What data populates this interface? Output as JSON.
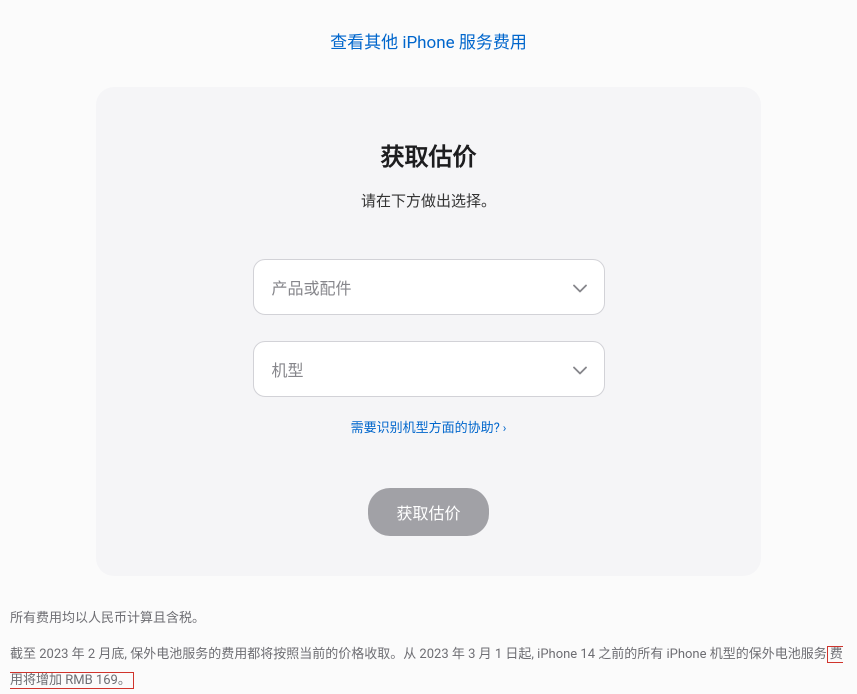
{
  "topLink": {
    "label": "查看其他 iPhone 服务费用"
  },
  "card": {
    "title": "获取估价",
    "subtitle": "请在下方做出选择。",
    "select1": {
      "placeholder": "产品或配件"
    },
    "select2": {
      "placeholder": "机型"
    },
    "helpLink": {
      "label": "需要识别机型方面的协助?"
    },
    "submit": {
      "label": "获取估价"
    }
  },
  "footer": {
    "note1": "所有费用均以人民币计算且含税。",
    "note2_part1": "截至 2023 年 2 月底, 保外电池服务的费用都将按照当前的价格收取。从 2023 年 3 月 1 日起, iPhone 14 之前的所有 iPhone 机型的保外电池服务",
    "note2_highlight": "费用将增加 RMB 169。"
  }
}
